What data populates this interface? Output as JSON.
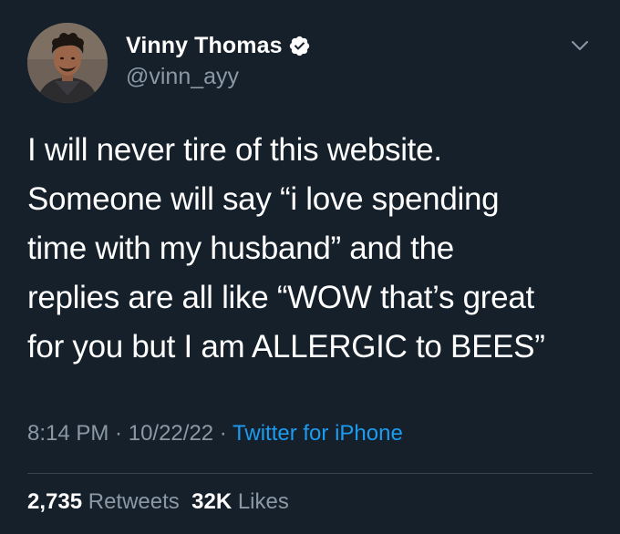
{
  "author": {
    "name": "Vinny Thomas",
    "handle": "@vinn_ayy",
    "verified": true
  },
  "tweet": {
    "lines": [
      "I will never tire of this website.",
      "Someone will say “i love spending",
      "time with my husband” and the",
      "replies are all like “WOW that’s great",
      "for you but I am ALLERGIC to BEES”"
    ]
  },
  "meta": {
    "time": "8:14 PM",
    "separator": " · ",
    "date": "10/22/22",
    "source": "Twitter for iPhone"
  },
  "stats": {
    "retweets_count": "2,735",
    "retweets_label": "Retweets",
    "likes_count": "32K",
    "likes_label": "Likes"
  },
  "colors": {
    "background": "#15202b",
    "accent": "#1d9bf0",
    "secondary_text": "#8b98a5",
    "divider": "#38444d"
  },
  "icons": {
    "verified": "verified-badge-icon",
    "menu": "chevron-down-icon"
  }
}
